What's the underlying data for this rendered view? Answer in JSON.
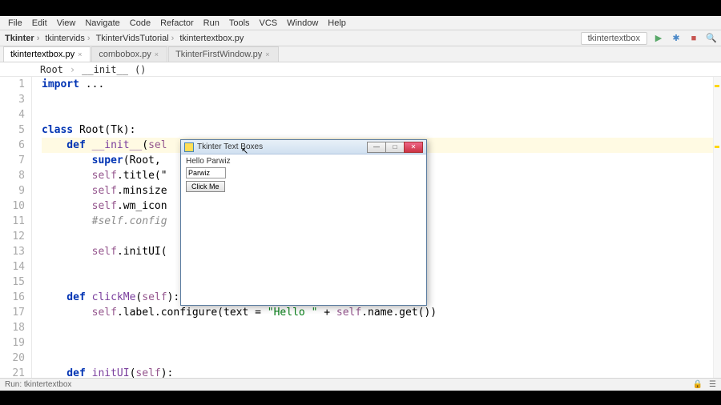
{
  "menubar": [
    "File",
    "Edit",
    "View",
    "Navigate",
    "Code",
    "Refactor",
    "Run",
    "Tools",
    "VCS",
    "Window",
    "Help"
  ],
  "nav": {
    "crumbs": [
      "Tkinter",
      "tkintervids",
      "TkinterVidsTutorial",
      "tkintertextbox.py"
    ],
    "run_config": "tkintertextbox"
  },
  "tabs": [
    {
      "label": "tkintertextbox.py",
      "active": true
    },
    {
      "label": "combobox.py",
      "active": false
    },
    {
      "label": "TkinterFirstWindow.py",
      "active": false
    }
  ],
  "breadcrumb": {
    "cls": "Root",
    "fn": "__init__",
    "suffix": "()"
  },
  "gutter": [
    "1",
    "3",
    "4",
    "5",
    "6",
    "7",
    "8",
    "9",
    "10",
    "11",
    "12",
    "13",
    "14",
    "15",
    "16",
    "17",
    "18",
    "19",
    "20",
    "21"
  ],
  "code": {
    "l1a": "import ",
    "l1b": "...",
    "l5a": "class ",
    "l5b": "Root(Tk):",
    "l6a": "    def ",
    "l6b": "__init__",
    "l6c": "(",
    "l6d": "sel",
    "l6e": "",
    "l7a": "        super",
    "l7b": "(Root,",
    "l8a": "        ",
    "l8b": "self",
    "l8c": ".title(\"",
    "l9a": "        ",
    "l9b": "self",
    "l9c": ".minsize",
    "l10a": "        ",
    "l10b": "self",
    "l10c": ".wm_icon",
    "l11": "        #self.config",
    "l13a": "        ",
    "l13b": "self",
    "l13c": ".initUI(",
    "l16a": "    def ",
    "l16b": "clickMe",
    "l16c": "(",
    "l16d": "self",
    "l16e": "):",
    "l17a": "        ",
    "l17b": "self",
    "l17c": ".label.configure(text = ",
    "l17d": "\"Hello \"",
    "l17e": " + ",
    "l17f": "self",
    "l17g": ".name.get())",
    "l21a": "    def ",
    "l21b": "initUI",
    "l21c": "(",
    "l21d": "self",
    "l21e": "):"
  },
  "popup": {
    "title": "Tkinter Text Boxes",
    "label": "Hello Parwiz",
    "input_value": "Parwiz",
    "button": "Click Me"
  },
  "status": {
    "left_a": "Run:",
    "left_b": "tkintertextbox"
  }
}
